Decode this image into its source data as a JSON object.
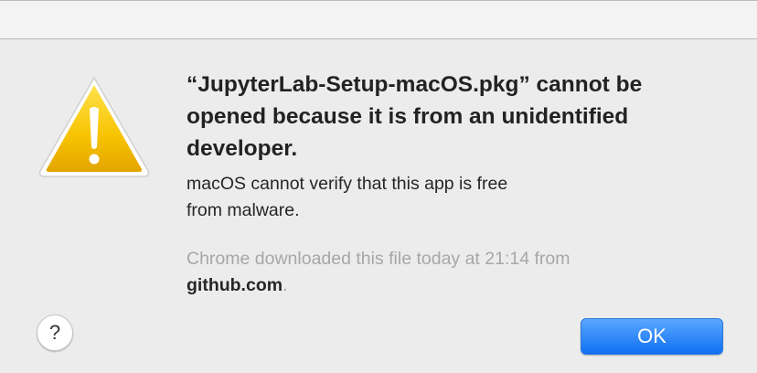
{
  "dialog": {
    "title": "“JupyterLab-Setup-macOS.pkg” cannot be\nopened because it is from an unidentified\ndeveloper.",
    "message": "macOS cannot verify that this app is free\nfrom malware.",
    "source_text": "Chrome downloaded this file today at 21:14 from",
    "source_domain": "github.com",
    "source_period": ".",
    "icon": "warning-triangle-icon",
    "help_label": "?",
    "ok_label": "OK"
  },
  "colors": {
    "accent": "#1a7cf8",
    "warning": "#f5c400",
    "background": "#ececec"
  }
}
